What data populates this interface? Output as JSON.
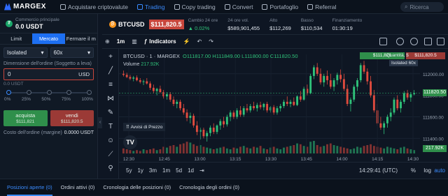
{
  "app": {
    "brand": "MARGEX"
  },
  "nav": {
    "items": [
      {
        "label": "Acquistare criptovalute",
        "icon": "card-icon"
      },
      {
        "label": "Trading",
        "icon": "chart-icon",
        "active": true
      },
      {
        "label": "Copy trading",
        "icon": "copy-icon"
      },
      {
        "label": "Convert",
        "icon": "convert-icon"
      },
      {
        "label": "Portafoglio",
        "icon": "wallet-icon"
      },
      {
        "label": "Referral",
        "icon": "referral-icon"
      }
    ],
    "search_placeholder": "Ricerca"
  },
  "account": {
    "label": "Commercio principale",
    "value": "0.0 USDT"
  },
  "order": {
    "tabs": [
      "Limit",
      "Mercato",
      "Fermare il m"
    ],
    "active_tab": "Mercato",
    "margin_mode": "Isolated",
    "leverage": "60x",
    "size_label": "Dimensione dell'ordine (Soggetto a leva)",
    "amount_value": "0",
    "amount_currency": "USD",
    "usd_value": "0.0 USDT",
    "slider_steps": [
      "0%",
      "25%",
      "50%",
      "75%",
      "100%"
    ],
    "slider_value": 0,
    "buy_label": "acquista",
    "buy_price": "$111,821",
    "sell_label": "vendi",
    "sell_price": "$111,820.5",
    "cost_label": "Costo dell'ordine (margine)",
    "cost_value": "0.0000 USDT"
  },
  "ticker": {
    "symbol": "BTCUSD",
    "price": "$111,820.5",
    "stats": [
      {
        "label": "Cambio 24 ore",
        "value": "▲ 0.02%",
        "tone": "green"
      },
      {
        "label": "24 ore vol.",
        "value": "$589,901,455"
      },
      {
        "label": "Alto",
        "value": "$112,269"
      },
      {
        "label": "Basso",
        "value": "$110,534"
      },
      {
        "label": "Finanziamento",
        "value": "01:30:19"
      }
    ]
  },
  "toolbar": {
    "interval": "1m",
    "indicators": "Indicators"
  },
  "chart_data": {
    "type": "candlestick",
    "symbol_line": "BTCUSD · 1 · MARGEX",
    "ohlc": {
      "O": "111817.00",
      "H": "111849.00",
      "L": "111800.00",
      "C": "111820.50"
    },
    "volume_label": "Volume",
    "volume_value": "217.92K",
    "x_ticks": [
      "12:30",
      "12:45",
      "13:00",
      "13:15",
      "13:30",
      "13:45",
      "14:00",
      "14:15",
      "14:30"
    ],
    "y_ticks": [
      "112000.00",
      "111800.00",
      "111600.00",
      "111400.00"
    ],
    "ylim": [
      111260,
      112180
    ],
    "last_price": "111820.50",
    "last_volume": "217.92K",
    "bid": "$111,821",
    "ask": "$111,820.5",
    "qty_label": "Quantità, $",
    "position_tag": "Isolated 60x",
    "alerts_label": "Avvisi di Prezzo",
    "candles": [
      {
        "o": 112000,
        "h": 112030,
        "l": 111975,
        "c": 111990
      },
      {
        "o": 111990,
        "h": 112010,
        "l": 111960,
        "c": 111970
      },
      {
        "o": 111970,
        "h": 111990,
        "l": 111940,
        "c": 111955
      },
      {
        "o": 111955,
        "h": 111980,
        "l": 111930,
        "c": 111965
      },
      {
        "o": 111965,
        "h": 111985,
        "l": 111930,
        "c": 111940
      },
      {
        "o": 111940,
        "h": 111960,
        "l": 111910,
        "c": 111925
      },
      {
        "o": 111925,
        "h": 111945,
        "l": 111895,
        "c": 111930
      },
      {
        "o": 111930,
        "h": 111960,
        "l": 111900,
        "c": 111910
      },
      {
        "o": 111910,
        "h": 111930,
        "l": 111850,
        "c": 111870
      },
      {
        "o": 111870,
        "h": 111900,
        "l": 111820,
        "c": 111840
      },
      {
        "o": 111840,
        "h": 111870,
        "l": 111800,
        "c": 111860
      },
      {
        "o": 111860,
        "h": 111890,
        "l": 111820,
        "c": 111830
      },
      {
        "o": 111830,
        "h": 111850,
        "l": 111770,
        "c": 111790
      },
      {
        "o": 111790,
        "h": 111830,
        "l": 111760,
        "c": 111810
      },
      {
        "o": 111810,
        "h": 111830,
        "l": 111740,
        "c": 111760
      },
      {
        "o": 111760,
        "h": 111790,
        "l": 111700,
        "c": 111720
      },
      {
        "o": 111720,
        "h": 111760,
        "l": 111680,
        "c": 111740
      },
      {
        "o": 111740,
        "h": 111760,
        "l": 111660,
        "c": 111680
      },
      {
        "o": 111680,
        "h": 111720,
        "l": 111620,
        "c": 111640
      },
      {
        "o": 111640,
        "h": 111670,
        "l": 111560,
        "c": 111590
      },
      {
        "o": 111590,
        "h": 111640,
        "l": 111540,
        "c": 111610
      },
      {
        "o": 111610,
        "h": 111630,
        "l": 111500,
        "c": 111520
      },
      {
        "o": 111520,
        "h": 111560,
        "l": 111430,
        "c": 111460
      },
      {
        "o": 111460,
        "h": 111500,
        "l": 111390,
        "c": 111480
      },
      {
        "o": 111480,
        "h": 111500,
        "l": 111400,
        "c": 111420
      },
      {
        "o": 111420,
        "h": 111470,
        "l": 111370,
        "c": 111450
      },
      {
        "o": 111450,
        "h": 111520,
        "l": 111420,
        "c": 111500
      },
      {
        "o": 111500,
        "h": 111540,
        "l": 111440,
        "c": 111460
      },
      {
        "o": 111460,
        "h": 111530,
        "l": 111440,
        "c": 111520
      },
      {
        "o": 111520,
        "h": 111580,
        "l": 111480,
        "c": 111560
      },
      {
        "o": 111560,
        "h": 111600,
        "l": 111500,
        "c": 111530
      },
      {
        "o": 111530,
        "h": 111620,
        "l": 111510,
        "c": 111600
      },
      {
        "o": 111600,
        "h": 111660,
        "l": 111560,
        "c": 111640
      },
      {
        "o": 111640,
        "h": 111660,
        "l": 111580,
        "c": 111600
      },
      {
        "o": 111600,
        "h": 111680,
        "l": 111580,
        "c": 111660
      },
      {
        "o": 111660,
        "h": 111700,
        "l": 111600,
        "c": 111620
      },
      {
        "o": 111620,
        "h": 111700,
        "l": 111600,
        "c": 111680
      },
      {
        "o": 111680,
        "h": 111720,
        "l": 111640,
        "c": 111660
      },
      {
        "o": 111660,
        "h": 111720,
        "l": 111640,
        "c": 111700
      },
      {
        "o": 111700,
        "h": 111740,
        "l": 111660,
        "c": 111680
      },
      {
        "o": 111680,
        "h": 111730,
        "l": 111650,
        "c": 111710
      },
      {
        "o": 111710,
        "h": 111740,
        "l": 111670,
        "c": 111690
      },
      {
        "o": 111690,
        "h": 111730,
        "l": 111660,
        "c": 111720
      },
      {
        "o": 111720,
        "h": 111740,
        "l": 111640,
        "c": 111660
      },
      {
        "o": 111660,
        "h": 111700,
        "l": 111640,
        "c": 111690
      },
      {
        "o": 111690,
        "h": 111710,
        "l": 111620,
        "c": 111640
      },
      {
        "o": 111640,
        "h": 111700,
        "l": 111620,
        "c": 111680
      },
      {
        "o": 111680,
        "h": 111720,
        "l": 111650,
        "c": 111700
      },
      {
        "o": 111700,
        "h": 111760,
        "l": 111680,
        "c": 111740
      },
      {
        "o": 111740,
        "h": 111790,
        "l": 111700,
        "c": 111720
      },
      {
        "o": 111720,
        "h": 111760,
        "l": 111690,
        "c": 111740
      },
      {
        "o": 111740,
        "h": 111780,
        "l": 111700,
        "c": 111710
      },
      {
        "o": 111710,
        "h": 111800,
        "l": 111700,
        "c": 111790
      },
      {
        "o": 111790,
        "h": 111840,
        "l": 111740,
        "c": 111760
      },
      {
        "o": 111760,
        "h": 111880,
        "l": 111750,
        "c": 111860
      },
      {
        "o": 111860,
        "h": 111900,
        "l": 111800,
        "c": 111820
      },
      {
        "o": 111820,
        "h": 112000,
        "l": 111810,
        "c": 111980
      },
      {
        "o": 111980,
        "h": 112080,
        "l": 111950,
        "c": 112060
      },
      {
        "o": 112060,
        "h": 112100,
        "l": 111980,
        "c": 112000
      },
      {
        "o": 112000,
        "h": 112050,
        "l": 111900,
        "c": 111920
      },
      {
        "o": 111920,
        "h": 112000,
        "l": 111880,
        "c": 111980
      },
      {
        "o": 111980,
        "h": 112030,
        "l": 111900,
        "c": 111940
      },
      {
        "o": 111940,
        "h": 112000,
        "l": 111860,
        "c": 111880
      },
      {
        "o": 111880,
        "h": 111960,
        "l": 111840,
        "c": 111940
      },
      {
        "o": 111940,
        "h": 112010,
        "l": 111900,
        "c": 111990
      },
      {
        "o": 111990,
        "h": 112040,
        "l": 111920,
        "c": 111950
      },
      {
        "o": 111950,
        "h": 112000,
        "l": 111840,
        "c": 111860
      },
      {
        "o": 111860,
        "h": 111900,
        "l": 111700,
        "c": 111720
      },
      {
        "o": 111720,
        "h": 111780,
        "l": 111650,
        "c": 111760
      },
      {
        "o": 111760,
        "h": 111900,
        "l": 111740,
        "c": 111880
      },
      {
        "o": 111880,
        "h": 111960,
        "l": 111840,
        "c": 111940
      },
      {
        "o": 111940,
        "h": 112100,
        "l": 111920,
        "c": 112080
      },
      {
        "o": 112080,
        "h": 112120,
        "l": 112000,
        "c": 112020
      },
      {
        "o": 112020,
        "h": 112050,
        "l": 111900,
        "c": 111930
      },
      {
        "o": 111930,
        "h": 111980,
        "l": 111780,
        "c": 111800
      },
      {
        "o": 111800,
        "h": 111850,
        "l": 111640,
        "c": 111660
      },
      {
        "o": 111660,
        "h": 111720,
        "l": 111520,
        "c": 111540
      },
      {
        "o": 111540,
        "h": 111600,
        "l": 111480,
        "c": 111500
      },
      {
        "o": 111500,
        "h": 111560,
        "l": 111440,
        "c": 111540
      },
      {
        "o": 111540,
        "h": 111620,
        "l": 111500,
        "c": 111600
      },
      {
        "o": 111600,
        "h": 111680,
        "l": 111560,
        "c": 111640
      },
      {
        "o": 111640,
        "h": 111780,
        "l": 111620,
        "c": 111760
      },
      {
        "o": 111760,
        "h": 111800,
        "l": 111660,
        "c": 111680
      },
      {
        "o": 111680,
        "h": 111760,
        "l": 111640,
        "c": 111740
      },
      {
        "o": 111740,
        "h": 111840,
        "l": 111720,
        "c": 111820
      },
      {
        "o": 111820,
        "h": 111850,
        "l": 111760,
        "c": 111780
      },
      {
        "o": 111780,
        "h": 111830,
        "l": 111740,
        "c": 111810
      },
      {
        "o": 111810,
        "h": 111849,
        "l": 111800,
        "c": 111820.5
      }
    ],
    "volumes": [
      6,
      5,
      4,
      3,
      4,
      3,
      5,
      4,
      5,
      6,
      4,
      5,
      8,
      7,
      9,
      10,
      8,
      11,
      12,
      14,
      13,
      11,
      9,
      10,
      8,
      7,
      6,
      5,
      6,
      7,
      8,
      6,
      5,
      7,
      6,
      8,
      9,
      7,
      6,
      8,
      7,
      9,
      6,
      5,
      7,
      8,
      6,
      5,
      7,
      8,
      9,
      10,
      12,
      11,
      9,
      8,
      14,
      15,
      10,
      8,
      9,
      11,
      12,
      10,
      9,
      8,
      7,
      6,
      5,
      6,
      8,
      7,
      9,
      10,
      11,
      9,
      8,
      7,
      6,
      8,
      7,
      6,
      5,
      7,
      8,
      6,
      5,
      4
    ]
  },
  "footer": {
    "periods": [
      "5y",
      "1y",
      "3m",
      "1m",
      "5d",
      "1d"
    ],
    "clock": "14:29:41 (UTC)",
    "pct": "%",
    "log": "log",
    "auto": "auto"
  },
  "bottom_tabs": [
    "Posizioni aperte (0)",
    "Ordini attivi (0)",
    "Cronologia delle posizioni (0)",
    "Cronologia degli ordini (0)"
  ],
  "colors": {
    "up": "#2fc27a",
    "down": "#e04b3e",
    "accent": "#1d6ff2",
    "bg": "#0e1623"
  }
}
